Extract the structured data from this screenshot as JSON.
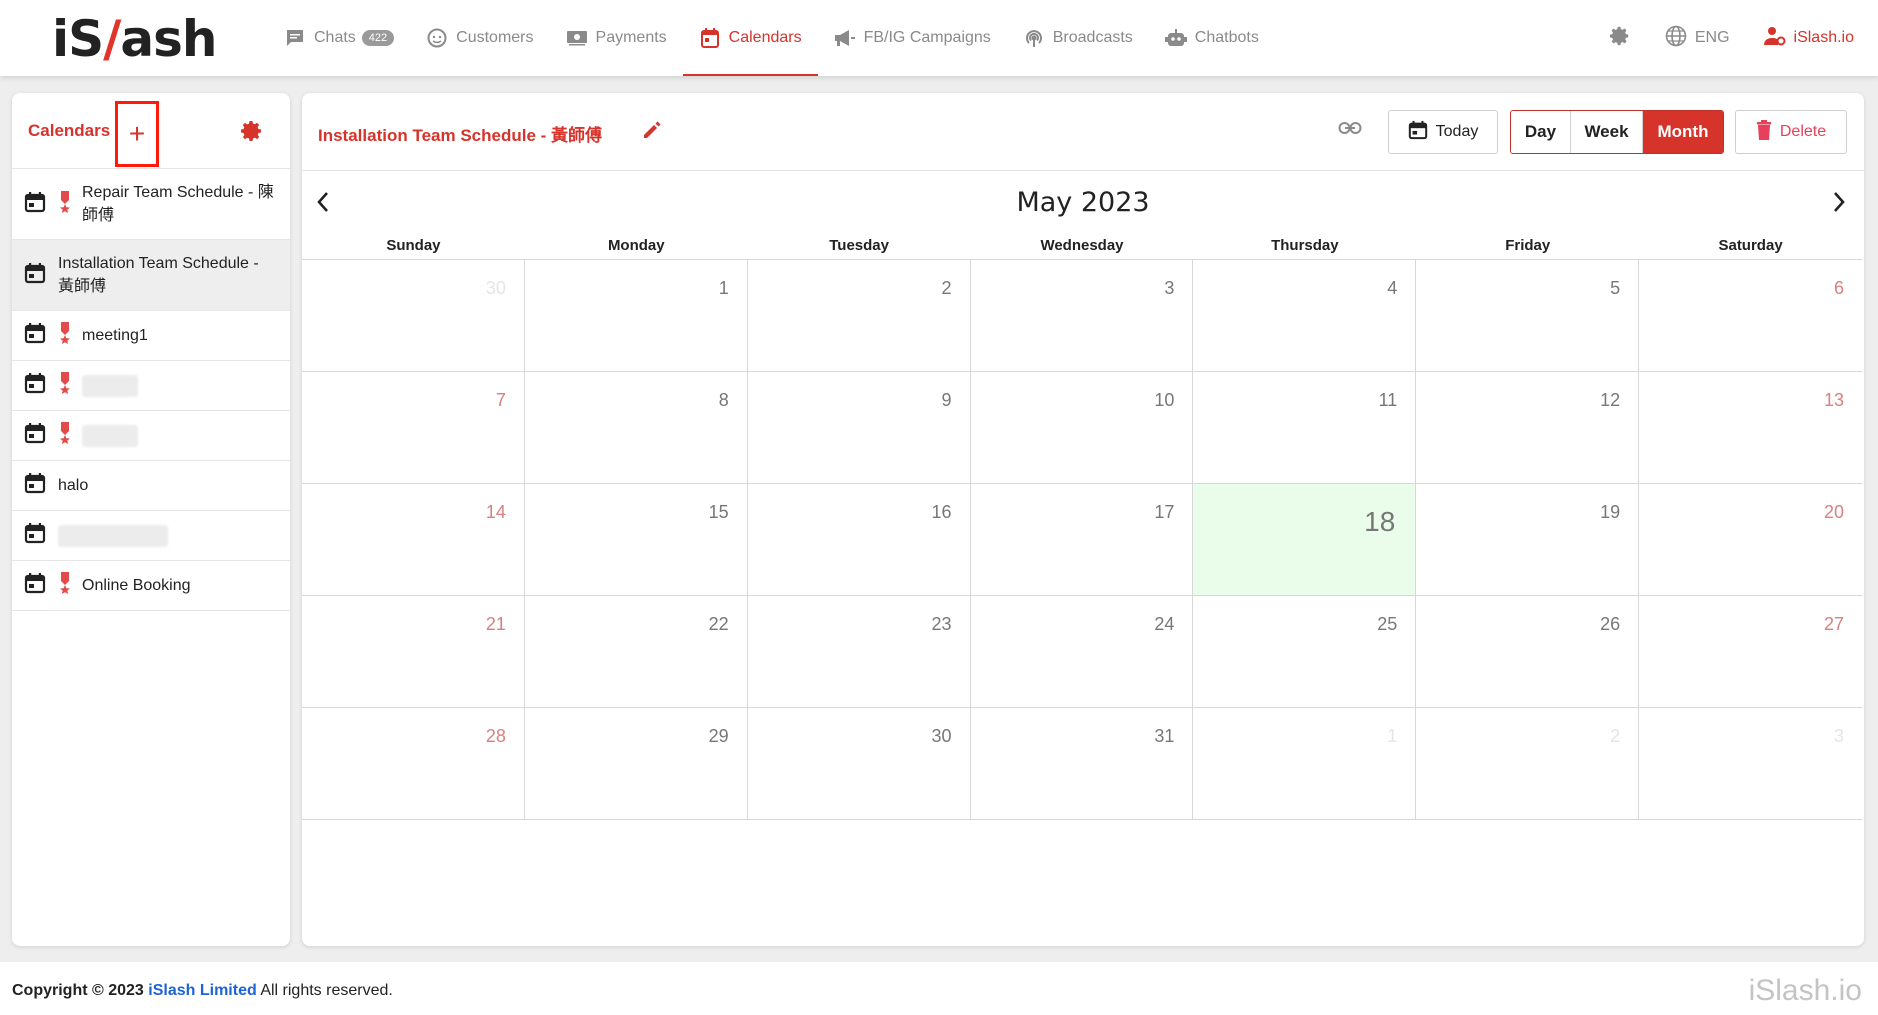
{
  "logo": {
    "prefix": "iS",
    "slash": "/",
    "suffix": "ash"
  },
  "nav": {
    "chats": "Chats",
    "chats_count": "422",
    "customers": "Customers",
    "payments": "Payments",
    "calendars": "Calendars",
    "campaigns": "FB/IG Campaigns",
    "broadcasts": "Broadcasts",
    "chatbots": "Chatbots",
    "language": "ENG",
    "user": "iSlash.io"
  },
  "sidebar": {
    "title": "Calendars",
    "add_label": "+",
    "items": [
      {
        "label": "Repair Team Schedule - 陳師傅",
        "has_ribbon": true
      },
      {
        "label": "Installation Team Schedule - 黃師傅",
        "has_ribbon": false,
        "selected": true
      },
      {
        "label": "meeting1",
        "has_ribbon": true
      },
      {
        "label": "",
        "has_ribbon": true
      },
      {
        "label": "",
        "has_ribbon": true
      },
      {
        "label": "halo",
        "has_ribbon": false
      },
      {
        "label": "",
        "has_ribbon": false
      },
      {
        "label": "Online Booking",
        "has_ribbon": true
      }
    ]
  },
  "main": {
    "title": "Installation Team Schedule - 黃師傅",
    "today_label": "Today",
    "views": {
      "day": "Day",
      "week": "Week",
      "month": "Month",
      "active": "Month"
    },
    "delete_label": "Delete",
    "month_title": "May 2023",
    "weekdays": [
      "Sunday",
      "Monday",
      "Tuesday",
      "Wednesday",
      "Thursday",
      "Friday",
      "Saturday"
    ],
    "days": [
      "30",
      "1",
      "2",
      "3",
      "4",
      "5",
      "6",
      "7",
      "8",
      "9",
      "10",
      "11",
      "12",
      "13",
      "14",
      "15",
      "16",
      "17",
      "18",
      "19",
      "20",
      "21",
      "22",
      "23",
      "24",
      "25",
      "26",
      "27",
      "28",
      "29",
      "30",
      "31",
      "1",
      "2",
      "3"
    ],
    "today": "18"
  },
  "footer": {
    "copyright": "Copyright © 2023",
    "company": "iSlash Limited",
    "rights": "All rights reserved.",
    "brand": "iSlash.io"
  },
  "colors": {
    "accent": "#d6332b",
    "link": "#1e63d6",
    "today_bg": "#eafcea",
    "highlight_box": "#ff1a0a"
  }
}
